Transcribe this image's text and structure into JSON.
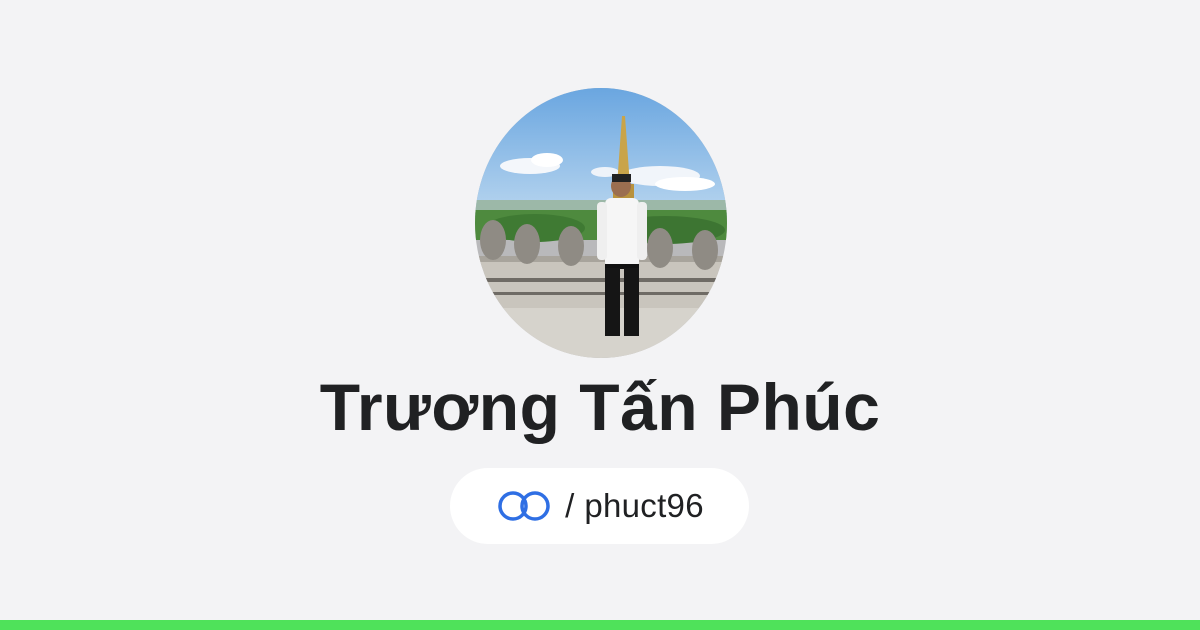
{
  "profile": {
    "name": "Trương Tấn Phúc",
    "separator": "/",
    "handle": "phuct96",
    "avatar_icon": "profile-photo"
  },
  "brand": {
    "logo_icon": "linked-rings-logo-icon",
    "logo_color": "#2f6fe4",
    "accent_bar_color": "#4fe25a",
    "background_color": "#f3f3f5"
  }
}
